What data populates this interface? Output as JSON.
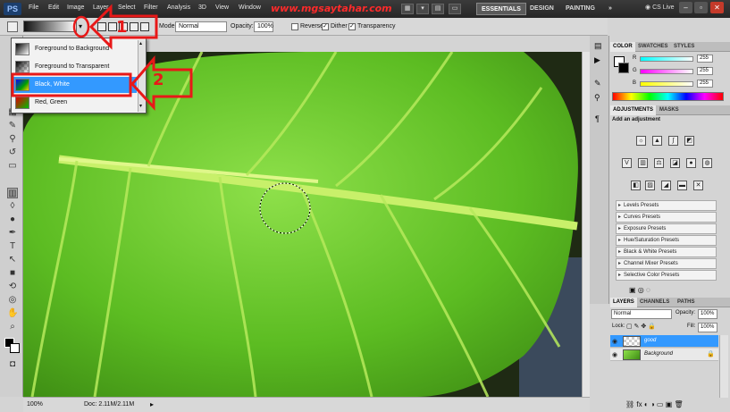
{
  "app": {
    "logo": "PS"
  },
  "menus": [
    "File",
    "Edit",
    "Image",
    "Layer",
    "Select",
    "Filter",
    "Analysis",
    "3D",
    "View",
    "Window"
  ],
  "watermark": "www.mgsaytahar.com",
  "workspaces": {
    "essentials": "ESSENTIALS",
    "design": "DESIGN",
    "painting": "PAINTING",
    "more": "»"
  },
  "cs_live": "CS Live",
  "options": {
    "mode_label": "Mode:",
    "mode_value": "Normal",
    "opacity_label": "Opacity:",
    "opacity_value": "100%",
    "reverse_label": "Reverse",
    "dither_label": "Dither",
    "transparency_label": "Transparency",
    "dither_checked": true,
    "transparency_checked": true
  },
  "gradient_picker": {
    "items": [
      {
        "label": "Foreground to Background",
        "selected": false
      },
      {
        "label": "Foreground to Transparent",
        "selected": false
      },
      {
        "label": "Black, White",
        "selected": true
      },
      {
        "label": "Red, Green",
        "selected": false
      }
    ]
  },
  "annotations": {
    "one": "1",
    "two": "2"
  },
  "status": {
    "zoom": "100%",
    "doc": "Doc: 2.11M/2.11M"
  },
  "color_panel": {
    "tabs": [
      "COLOR",
      "SWATCHES",
      "STYLES"
    ],
    "r_label": "R",
    "g_label": "G",
    "b_label": "B",
    "r": "255",
    "g": "255",
    "b": "255"
  },
  "adjustments_panel": {
    "tabs": [
      "ADJUSTMENTS",
      "MASKS"
    ],
    "title": "Add an adjustment",
    "presets": [
      "Levels Presets",
      "Curves Presets",
      "Exposure Presets",
      "Hue/Saturation Presets",
      "Black & White Presets",
      "Channel Mixer Presets",
      "Selective Color Presets"
    ]
  },
  "layers_panel": {
    "tabs": [
      "LAYERS",
      "CHANNELS",
      "PATHS"
    ],
    "blend": "Normal",
    "opacity_label": "Opacity:",
    "opacity": "100%",
    "lock_label": "Lock:",
    "fill_label": "Fill:",
    "fill": "100%",
    "layers": [
      {
        "name": "good",
        "selected": true
      },
      {
        "name": "Background",
        "selected": false
      }
    ]
  },
  "colors": {
    "accent": "#3399ff",
    "annotation_red": "#e81818",
    "leaf_green": "#6cc82a"
  }
}
